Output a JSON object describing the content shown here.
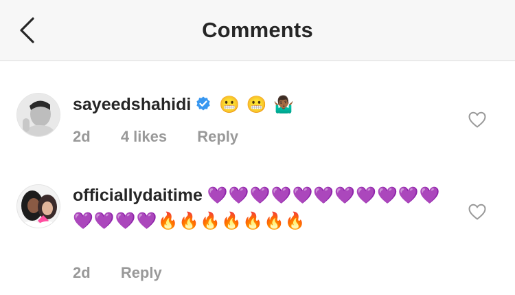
{
  "header": {
    "title": "Comments",
    "back_icon": "chevron-left-icon"
  },
  "comments": [
    {
      "username": "sayeedshahidi",
      "verified": true,
      "text": "😬 😬 🤷🏾‍♂️",
      "time": "2d",
      "likes": "4 likes",
      "reply": "Reply"
    },
    {
      "username": "officiallydaitime",
      "verified": false,
      "text": "💜💜💜💜💜💜💜💜💜💜💜💜💜💜💜🔥🔥🔥🔥🔥🔥🔥",
      "time": "2d",
      "reply": "Reply"
    }
  ],
  "colors": {
    "verified_badge": "#3897f0",
    "meta_text": "#999999",
    "header_bg": "#f7f7f7"
  }
}
